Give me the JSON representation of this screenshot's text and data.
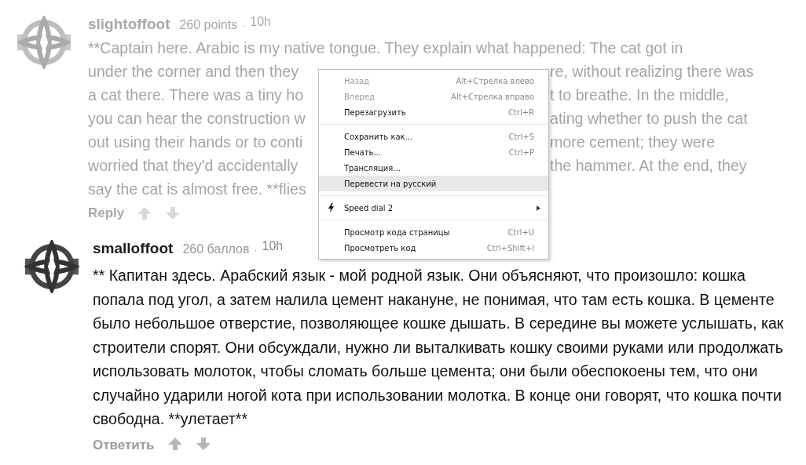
{
  "comments": [
    {
      "dimmed": true,
      "author": "slightoffoot",
      "points": "260 points",
      "separator": "·",
      "time": "10h",
      "lines": [
        {
          "left": "**Captain here. Arabic is my native tongue. They explain what happened: The cat got in"
        },
        {
          "left": "under the corner and then they",
          "right": "re, without realizing there was"
        },
        {
          "left": "a cat there. There was a tiny ho",
          "right": "t to breathe. In the middle,"
        },
        {
          "left": "you can hear the construction w",
          "right": "ating whether to push the cat"
        },
        {
          "left": "out using their hands or to conti",
          "right": "more cement; they were"
        },
        {
          "left": "worried that they'd accidentally",
          "right": "the hammer. At the end, they"
        },
        {
          "left": "say the cat is almost free. **flies"
        }
      ],
      "reply": "Reply"
    },
    {
      "dimmed": false,
      "author": "smalloffoot",
      "points": "260 баллов",
      "separator": "·",
      "time": "10h",
      "text": "** Капитан здесь. Арабский язык - мой родной язык. Они объясняют, что произошло: кошка попала под угол, а затем налила цемент накануне, не понимая, что там есть кошка. В цементе было небольшое отверстие, позволяющее кошке дышать. В середине вы можете услышать, как строители спорят. Они обсуждали, нужно ли выталкивать кошку своими руками или продолжать использовать молоток, чтобы сломать больше цемента; они были обеспокоены тем, что они случайно ударили ногой кота при использовании молотка. В конце они говорят, что кошка почти свободна. **улетает**",
      "reply": "Ответить"
    }
  ],
  "context_menu": {
    "items": [
      {
        "kind": "item",
        "label": "Назад",
        "shortcut": "Alt+Стрелка влево",
        "disabled": true,
        "highlighted": false
      },
      {
        "kind": "item",
        "label": "Вперед",
        "shortcut": "Alt+Стрелка вправо",
        "disabled": true,
        "highlighted": false
      },
      {
        "kind": "item",
        "label": "Перезагрузить",
        "shortcut": "Ctrl+R",
        "disabled": false,
        "highlighted": false
      },
      {
        "kind": "separator"
      },
      {
        "kind": "item",
        "label": "Сохранить как...",
        "shortcut": "Ctrl+S",
        "disabled": false,
        "highlighted": false
      },
      {
        "kind": "item",
        "label": "Печать...",
        "shortcut": "Ctrl+P",
        "disabled": false,
        "highlighted": false
      },
      {
        "kind": "item",
        "label": "Трансляция...",
        "disabled": false,
        "highlighted": false
      },
      {
        "kind": "item",
        "label": "Перевести на русский",
        "disabled": false,
        "highlighted": true
      },
      {
        "kind": "separator"
      },
      {
        "kind": "extension",
        "label": "Speed dial 2",
        "disabled": false,
        "highlighted": false
      },
      {
        "kind": "separator"
      },
      {
        "kind": "item",
        "label": "Просмотр кода страницы",
        "shortcut": "Ctrl+U",
        "disabled": false,
        "highlighted": false
      },
      {
        "kind": "item",
        "label": "Просмотреть код",
        "shortcut": "Ctrl+Shift+I",
        "disabled": false,
        "highlighted": false
      }
    ]
  }
}
